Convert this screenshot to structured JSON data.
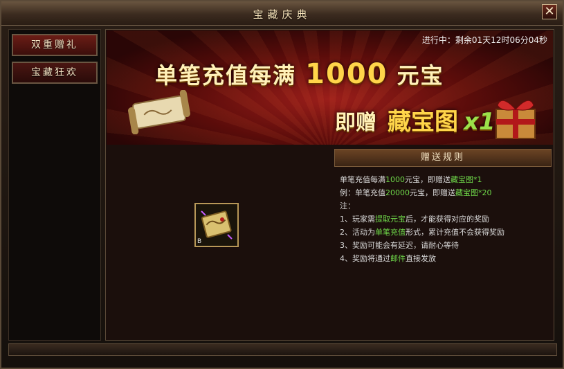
{
  "window": {
    "title": "宝藏庆典",
    "close_label": "✕"
  },
  "sidebar": {
    "tabs": [
      {
        "label": "双重赠礼",
        "active": true
      },
      {
        "label": "宝藏狂欢",
        "active": false
      }
    ]
  },
  "banner": {
    "status": "进行中：剩余01天12时06分04秒",
    "headline1_prefix": "单笔充值每满",
    "headline1_amount": "1000",
    "headline1_suffix": "元宝",
    "headline2_prefix": "即赠",
    "headline2_item": "藏宝图",
    "headline2_mult": "x1"
  },
  "rules": {
    "header": "赠送规则",
    "line1": {
      "a": "单笔充值每满",
      "b": "1000",
      "c": "元宝，即赠送",
      "d": "藏宝图*1"
    },
    "line2": {
      "a": "例：单笔充值",
      "b": "20000",
      "c": "元宝，即赠送",
      "d": "藏宝图*20"
    },
    "line3": "注：",
    "line4": {
      "a": "1、玩家需",
      "b": "提取元宝",
      "c": "后，才能获得对应的奖励"
    },
    "line5": {
      "a": "2、活动为",
      "b": "单笔充值",
      "c": "形式，累计充值不会获得奖励"
    },
    "line6": "3、奖励可能会有延迟，请耐心等待",
    "line7": {
      "a": "4、奖励将通过",
      "b": "邮件",
      "c": "直接发放"
    }
  },
  "reward": {
    "icon": "treasure-map-icon",
    "badge": "B"
  },
  "colors": {
    "highlight": "#6fd84a",
    "gold": "#ffd54a",
    "text": "#d9d9d9"
  }
}
